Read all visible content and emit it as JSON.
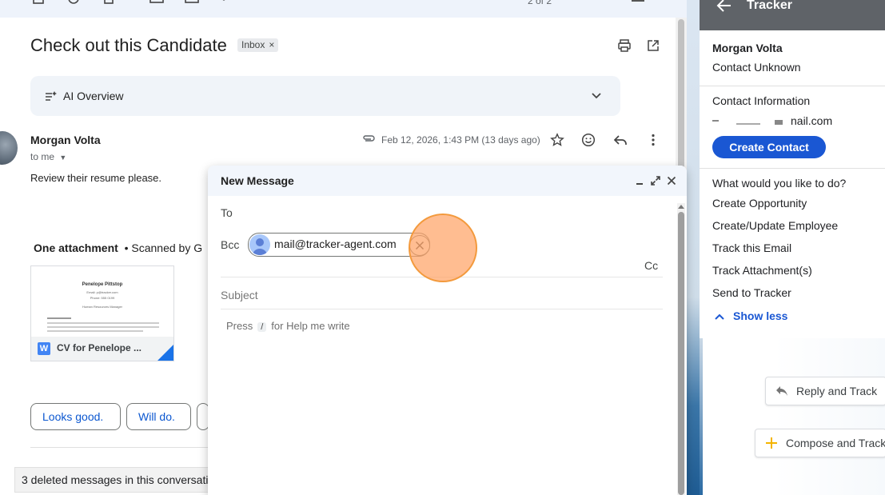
{
  "toolbar": {
    "pager": "2 of 2"
  },
  "email": {
    "subject": "Check out this Candidate",
    "label_chip": "Inbox",
    "label_chip_close": "×",
    "ai_overview_label": "AI Overview",
    "sender_name": "Morgan Volta",
    "to_me": "to me",
    "date": "Feb 12, 2026, 1:43 PM (13 days ago)",
    "body": "Review their resume please.",
    "attachment_heading": "One attachment",
    "attachment_scan": "•  Scanned by G",
    "attachment_name": "CV for Penelope ...",
    "attachment_badge": "W",
    "preview": {
      "name": "Penelope Pittstop",
      "email": "Email: p@tracker.com",
      "phone": "Phone: 555 0199",
      "role": "Human Resources Manager"
    },
    "smart_replies": [
      "Looks good.",
      "Will do."
    ],
    "deleted_notice": "3 deleted messages in this conversation"
  },
  "compose": {
    "title": "New Message",
    "to_label": "To",
    "bcc_label": "Bcc",
    "bcc_recipient": "mail@tracker-agent.com",
    "cc_label": "Cc",
    "subject_placeholder": "Subject",
    "body_hint_prefix": "Press",
    "body_hint_key": "/",
    "body_hint_suffix": "for Help me write"
  },
  "tracker": {
    "title": "Tracker",
    "contact_name": "Morgan Volta",
    "contact_status": "Contact Unknown",
    "contact_info_heading": "Contact Information",
    "contact_email_partial": "nail.com",
    "create_contact_label": "Create Contact",
    "actions_heading": "What would you like to do?",
    "actions": [
      "Create Opportunity",
      "Create/Update Employee",
      "Track this Email",
      "Track Attachment(s)",
      "Send to Tracker"
    ],
    "show_less_label": "Show less",
    "reply_and_track_label": "Reply and Track",
    "compose_and_track_label": "Compose and Track"
  },
  "colors": {
    "accent_blue": "#1a57d3",
    "compose_header": "#f2f6fc",
    "tracker_header": "#5f6368",
    "click_highlight": "#ffa366"
  }
}
